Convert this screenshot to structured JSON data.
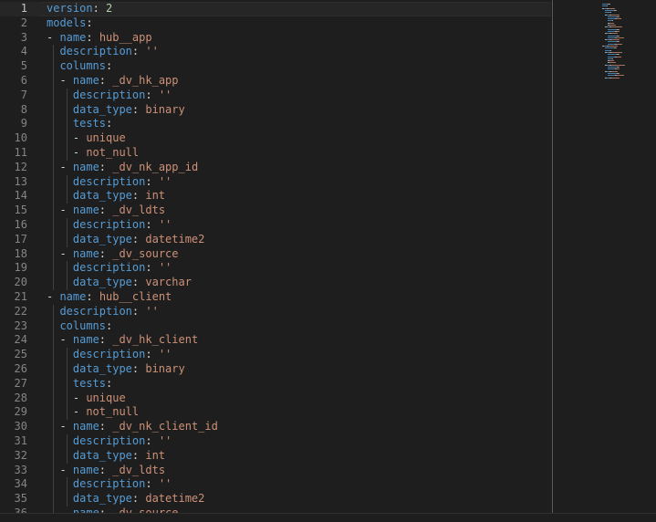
{
  "editor": {
    "language": "yaml",
    "current_line": 1,
    "colors": {
      "key": "#569cd6",
      "string": "#ce9178",
      "number": "#b5cea8",
      "punct": "#d4d4d4",
      "line_number": "#858585",
      "background": "#1e1e1e"
    },
    "lines": [
      {
        "num": "1",
        "indent": 0,
        "dash": false,
        "key": "version",
        "sep": ": ",
        "value": "2",
        "vtype": "n"
      },
      {
        "num": "2",
        "indent": 0,
        "dash": false,
        "key": "models",
        "sep": ":",
        "value": "",
        "vtype": "s"
      },
      {
        "num": "3",
        "indent": 0,
        "dash": true,
        "key": "name",
        "sep": ": ",
        "value": "hub__app",
        "vtype": "s"
      },
      {
        "num": "4",
        "indent": 1,
        "dash": false,
        "key": "description",
        "sep": ": ",
        "value": "''",
        "vtype": "s"
      },
      {
        "num": "5",
        "indent": 1,
        "dash": false,
        "key": "columns",
        "sep": ":",
        "value": "",
        "vtype": "s"
      },
      {
        "num": "6",
        "indent": 1,
        "dash": true,
        "key": "name",
        "sep": ": ",
        "value": "_dv_hk_app",
        "vtype": "s"
      },
      {
        "num": "7",
        "indent": 2,
        "dash": false,
        "key": "description",
        "sep": ": ",
        "value": "''",
        "vtype": "s"
      },
      {
        "num": "8",
        "indent": 2,
        "dash": false,
        "key": "data_type",
        "sep": ": ",
        "value": "binary",
        "vtype": "s"
      },
      {
        "num": "9",
        "indent": 2,
        "dash": false,
        "key": "tests",
        "sep": ":",
        "value": "",
        "vtype": "s"
      },
      {
        "num": "10",
        "indent": 2,
        "dash": true,
        "key": "",
        "sep": "",
        "value": "unique",
        "vtype": "s"
      },
      {
        "num": "11",
        "indent": 2,
        "dash": true,
        "key": "",
        "sep": "",
        "value": "not_null",
        "vtype": "s"
      },
      {
        "num": "12",
        "indent": 1,
        "dash": true,
        "key": "name",
        "sep": ": ",
        "value": "_dv_nk_app_id",
        "vtype": "s"
      },
      {
        "num": "13",
        "indent": 2,
        "dash": false,
        "key": "description",
        "sep": ": ",
        "value": "''",
        "vtype": "s"
      },
      {
        "num": "14",
        "indent": 2,
        "dash": false,
        "key": "data_type",
        "sep": ": ",
        "value": "int",
        "vtype": "s"
      },
      {
        "num": "15",
        "indent": 1,
        "dash": true,
        "key": "name",
        "sep": ": ",
        "value": "_dv_ldts",
        "vtype": "s"
      },
      {
        "num": "16",
        "indent": 2,
        "dash": false,
        "key": "description",
        "sep": ": ",
        "value": "''",
        "vtype": "s"
      },
      {
        "num": "17",
        "indent": 2,
        "dash": false,
        "key": "data_type",
        "sep": ": ",
        "value": "datetime2",
        "vtype": "s"
      },
      {
        "num": "18",
        "indent": 1,
        "dash": true,
        "key": "name",
        "sep": ": ",
        "value": "_dv_source",
        "vtype": "s"
      },
      {
        "num": "19",
        "indent": 2,
        "dash": false,
        "key": "description",
        "sep": ": ",
        "value": "''",
        "vtype": "s"
      },
      {
        "num": "20",
        "indent": 2,
        "dash": false,
        "key": "data_type",
        "sep": ": ",
        "value": "varchar",
        "vtype": "s"
      },
      {
        "num": "21",
        "indent": 0,
        "dash": true,
        "key": "name",
        "sep": ": ",
        "value": "hub__client",
        "vtype": "s"
      },
      {
        "num": "22",
        "indent": 1,
        "dash": false,
        "key": "description",
        "sep": ": ",
        "value": "''",
        "vtype": "s"
      },
      {
        "num": "23",
        "indent": 1,
        "dash": false,
        "key": "columns",
        "sep": ":",
        "value": "",
        "vtype": "s"
      },
      {
        "num": "24",
        "indent": 1,
        "dash": true,
        "key": "name",
        "sep": ": ",
        "value": "_dv_hk_client",
        "vtype": "s"
      },
      {
        "num": "25",
        "indent": 2,
        "dash": false,
        "key": "description",
        "sep": ": ",
        "value": "''",
        "vtype": "s"
      },
      {
        "num": "26",
        "indent": 2,
        "dash": false,
        "key": "data_type",
        "sep": ": ",
        "value": "binary",
        "vtype": "s"
      },
      {
        "num": "27",
        "indent": 2,
        "dash": false,
        "key": "tests",
        "sep": ":",
        "value": "",
        "vtype": "s"
      },
      {
        "num": "28",
        "indent": 2,
        "dash": true,
        "key": "",
        "sep": "",
        "value": "unique",
        "vtype": "s"
      },
      {
        "num": "29",
        "indent": 2,
        "dash": true,
        "key": "",
        "sep": "",
        "value": "not_null",
        "vtype": "s"
      },
      {
        "num": "30",
        "indent": 1,
        "dash": true,
        "key": "name",
        "sep": ": ",
        "value": "_dv_nk_client_id",
        "vtype": "s"
      },
      {
        "num": "31",
        "indent": 2,
        "dash": false,
        "key": "description",
        "sep": ": ",
        "value": "''",
        "vtype": "s"
      },
      {
        "num": "32",
        "indent": 2,
        "dash": false,
        "key": "data_type",
        "sep": ": ",
        "value": "int",
        "vtype": "s"
      },
      {
        "num": "33",
        "indent": 1,
        "dash": true,
        "key": "name",
        "sep": ": ",
        "value": "_dv_ldts",
        "vtype": "s"
      },
      {
        "num": "34",
        "indent": 2,
        "dash": false,
        "key": "description",
        "sep": ": ",
        "value": "''",
        "vtype": "s"
      },
      {
        "num": "35",
        "indent": 2,
        "dash": false,
        "key": "data_type",
        "sep": ": ",
        "value": "datetime2",
        "vtype": "s"
      },
      {
        "num": "36",
        "indent": 1,
        "dash": true,
        "key": "name",
        "sep": ": ",
        "value": "_dv_source",
        "vtype": "s"
      }
    ]
  }
}
